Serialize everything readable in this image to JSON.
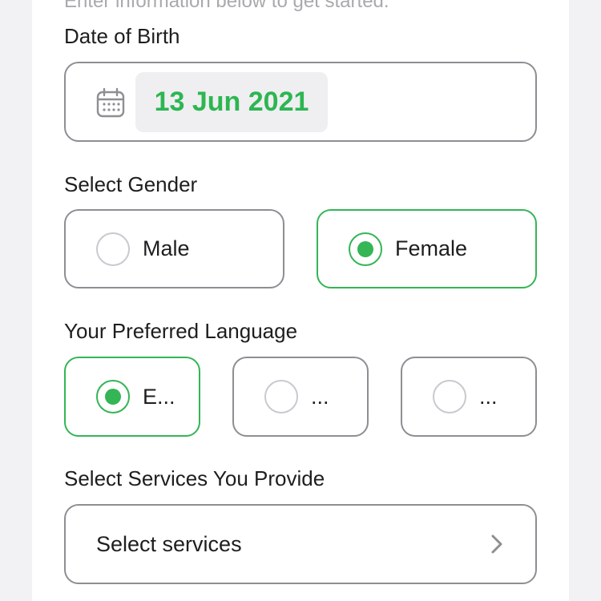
{
  "intro_text": "Enter information below to get started.",
  "dob": {
    "label": "Date of Birth",
    "value": "13 Jun 2021",
    "icon": "calendar-icon"
  },
  "gender": {
    "label": "Select Gender",
    "options": [
      {
        "label": "Male",
        "selected": false
      },
      {
        "label": "Female",
        "selected": true
      }
    ]
  },
  "language": {
    "label": "Your Preferred Language",
    "options": [
      {
        "label": "E...",
        "selected": true
      },
      {
        "label": "...",
        "selected": false
      },
      {
        "label": "...",
        "selected": false
      }
    ]
  },
  "services": {
    "label": "Select Services You Provide",
    "placeholder": "Select services",
    "icon": "chevron-right-icon"
  },
  "colors": {
    "accent": "#34b556",
    "date_text": "#2db652",
    "border": "#8e8e93",
    "radio_off": "#c9c9cf"
  }
}
